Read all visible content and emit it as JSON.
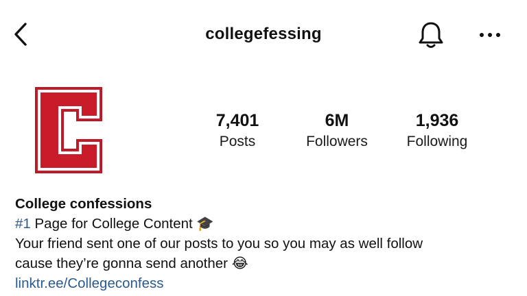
{
  "header": {
    "username": "collegefessing",
    "back_icon": "chevron-left-icon",
    "bell_icon": "bell-icon",
    "more_icon": "more-horizontal-icon"
  },
  "avatar": {
    "letter": "C",
    "colors": {
      "fill": "#c81c2a",
      "outline": "#ffffff",
      "edge": "#b51a26"
    }
  },
  "stats": [
    {
      "value": "7,401",
      "label": "Posts"
    },
    {
      "value": "6M",
      "label": "Followers"
    },
    {
      "value": "1,936",
      "label": "Following"
    }
  ],
  "bio": {
    "name": "College confessions",
    "line1_hashtag": "#1",
    "line1_text": " Page for College Content ",
    "line1_emoji": "🎓",
    "line2": "Your friend sent one of our posts to you so you may as well follow",
    "line3_text": "cause they’re gonna send another ",
    "line3_emoji": "😂",
    "link": "linktr.ee/Collegeconfess"
  },
  "colors": {
    "link": "#2b5a8c",
    "text": "#111111",
    "background": "#ffffff"
  }
}
